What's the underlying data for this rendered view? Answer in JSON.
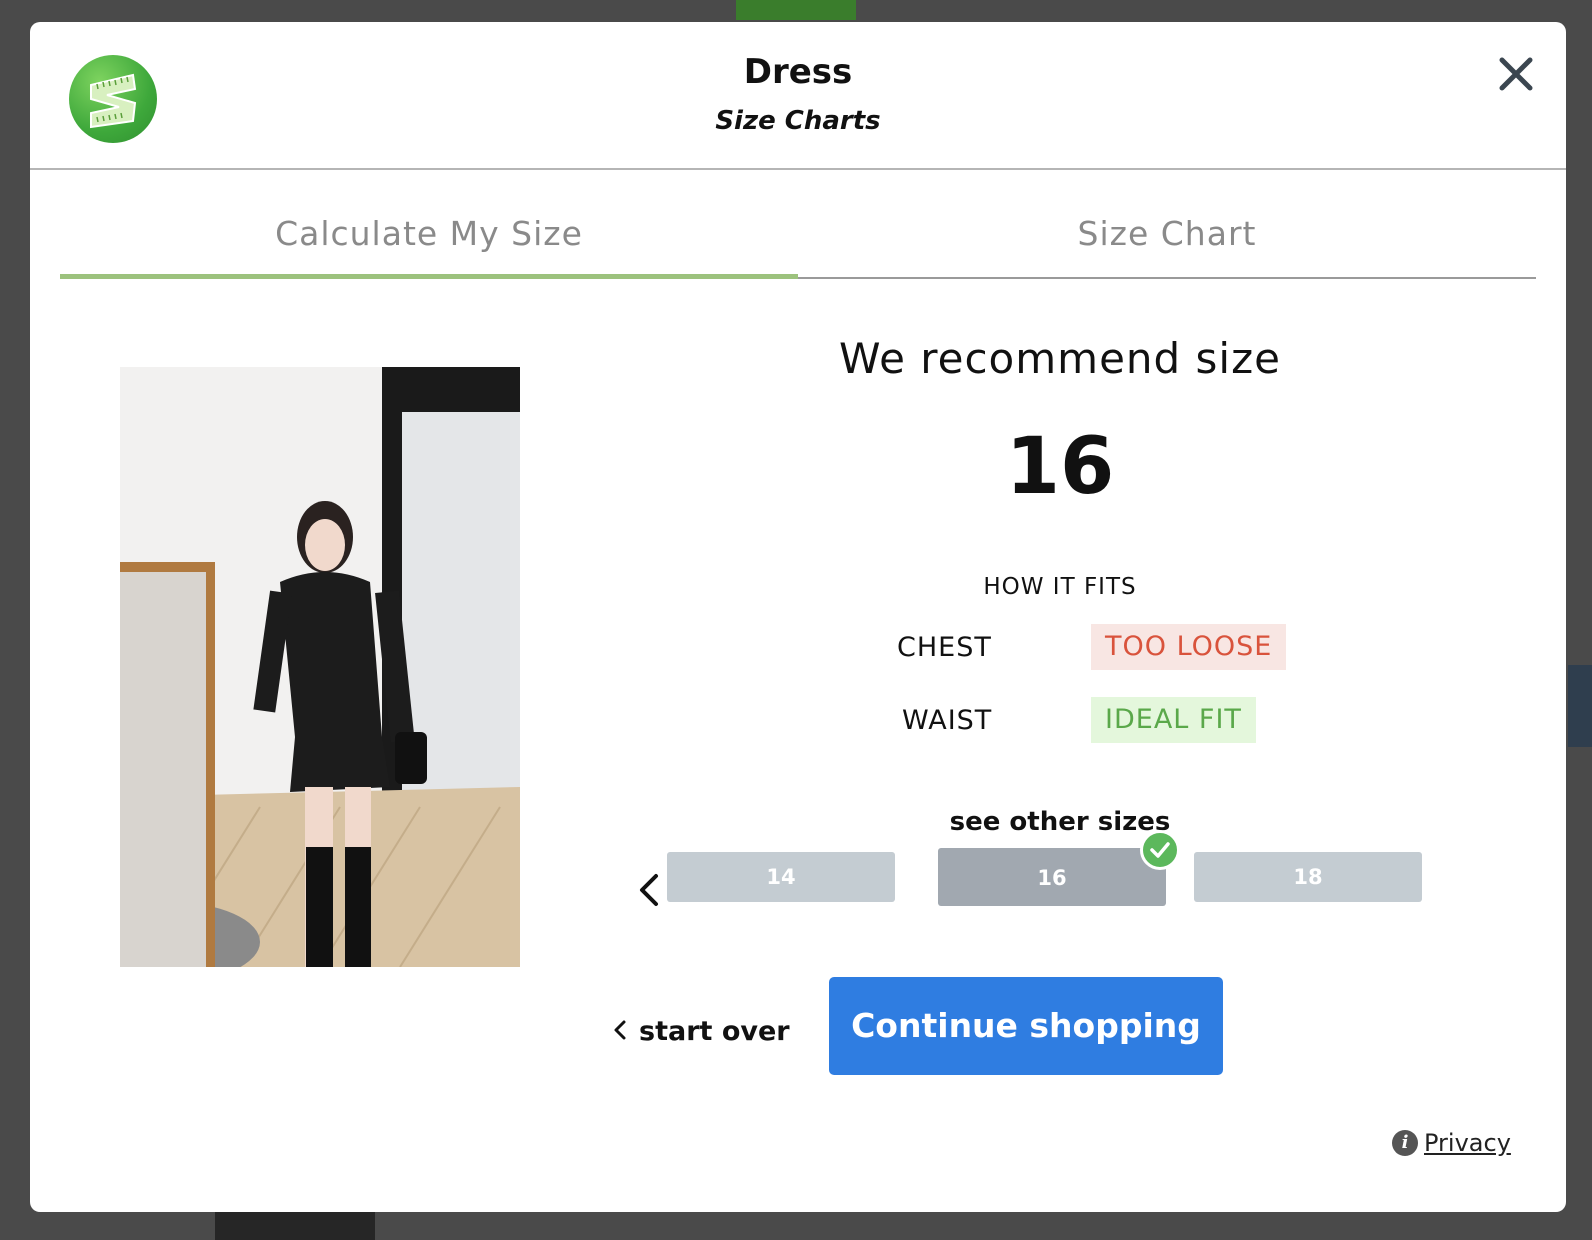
{
  "header": {
    "title": "Dress",
    "subtitle": "Size Charts",
    "logo_icon": "ruler-s-logo",
    "close_icon": "close-icon"
  },
  "tabs": [
    {
      "label": "Calculate My Size",
      "active": true
    },
    {
      "label": "Size Chart",
      "active": false
    }
  ],
  "recommendation": {
    "heading": "We recommend size",
    "size": "16",
    "how_it_fits": "HOW IT FITS",
    "fits": [
      {
        "area": "CHEST",
        "result": "TOO LOOSE",
        "color": "#d9533c"
      },
      {
        "area": "WAIST",
        "result": "IDEAL FIT",
        "color": "#5aa84a"
      }
    ]
  },
  "other_sizes": {
    "heading": "see other sizes",
    "sizes": [
      "14",
      "16",
      "18"
    ],
    "selected": "16"
  },
  "actions": {
    "start_over": "start over",
    "continue": "Continue shopping"
  },
  "footer": {
    "privacy": "Privacy"
  },
  "colors": {
    "accent_tab": "#9cc27d",
    "button_primary": "#2f7de1"
  }
}
